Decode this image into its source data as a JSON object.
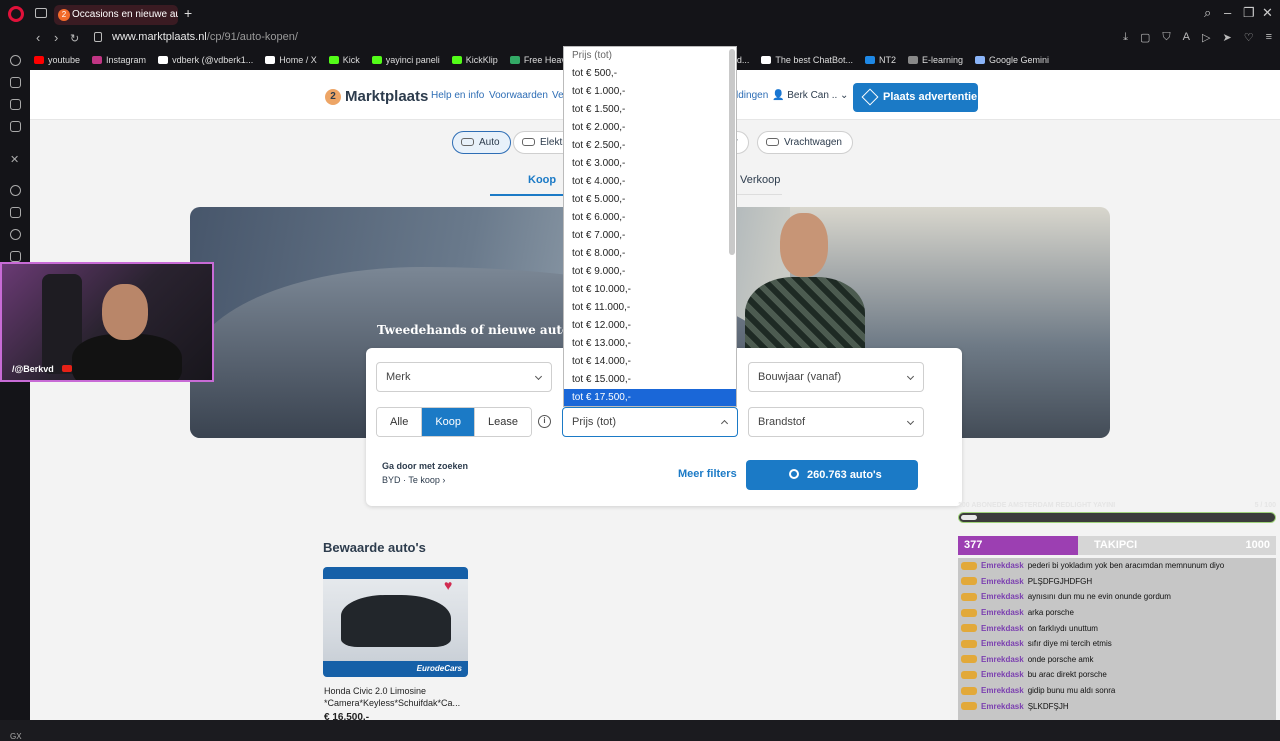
{
  "tab": {
    "title": "Occasions en nieuwe au",
    "badge": "2"
  },
  "address": {
    "host": "www.marktplaats.nl",
    "path": "/cp/91/auto-kopen/"
  },
  "bookmarks": [
    {
      "label": "youtube",
      "color": "#ff0000"
    },
    {
      "label": "Instagram",
      "color": "#c13584"
    },
    {
      "label": "vdberk (@vdberk1...",
      "color": "#ffffff"
    },
    {
      "label": "Home / X",
      "color": "#ffffff"
    },
    {
      "label": "Kick",
      "color": "#53fc18"
    },
    {
      "label": "yayinci paneli",
      "color": "#53fc18"
    },
    {
      "label": "KickKlip",
      "color": "#53fc18"
    },
    {
      "label": "Free Heavy Me",
      "color": "#33aa66"
    },
    {
      "label": "tech-c...",
      "color": "#888888"
    },
    {
      "label": "katlanabilir yarış d...",
      "color": "#f5821f"
    },
    {
      "label": "The best ChatBot...",
      "color": "#ffffff"
    },
    {
      "label": "NT2",
      "color": "#1e88e5"
    },
    {
      "label": "E-learning",
      "color": "#888888"
    },
    {
      "label": "Google Gemini",
      "color": "#8ab4f8"
    }
  ],
  "header": {
    "logo": "Marktplaats",
    "links": [
      "Help en info",
      "Voorwaarden",
      "Ve"
    ],
    "messages_tail": "ldingen",
    "user": "Berk Can ..",
    "place_ad": "Plaats advertentie"
  },
  "categories": [
    "Auto",
    "Elektr",
    "er",
    "Vrachtwagen"
  ],
  "buy_sell": {
    "buy": "Koop",
    "sell": "Verkoop"
  },
  "hero": {
    "title": "Tweedehands of nieuwe auto ko"
  },
  "search": {
    "brand": "Merk",
    "year": "Bouwjaar (vanaf)",
    "segment": [
      "Alle",
      "Koop",
      "Lease"
    ],
    "segment_active": "Koop",
    "price": "Prijs (tot)",
    "fuel": "Brandstof",
    "continue_title": "Ga door met zoeken",
    "continue_sub": "BYD · Te koop",
    "more_filters": "Meer filters",
    "results_button": "260.763 auto's"
  },
  "price_dropdown": {
    "options": [
      "Prijs (tot)",
      "tot € 500,-",
      "tot € 1.000,-",
      "tot € 1.500,-",
      "tot € 2.000,-",
      "tot € 2.500,-",
      "tot € 3.000,-",
      "tot € 4.000,-",
      "tot € 5.000,-",
      "tot € 6.000,-",
      "tot € 7.000,-",
      "tot € 8.000,-",
      "tot € 9.000,-",
      "tot € 10.000,-",
      "tot € 11.000,-",
      "tot € 12.000,-",
      "tot € 13.000,-",
      "tot € 14.000,-",
      "tot € 15.000,-",
      "tot € 17.500,-"
    ],
    "highlighted": "tot € 17.500,-"
  },
  "saved": {
    "title": "Bewaarde auto's",
    "card_title": "Honda Civic 2.0 Limosine *Camera*Keyless*Schuifdak*Ca...",
    "card_price": "€ 16.500,-",
    "card_banner": "EurodeCars"
  },
  "stream": {
    "cam_tag": "/@Berkvd",
    "goal_label": "100 ABONEDE AMSTERDAM REDLIGHT YAYINI",
    "goal_count": "5 / 100",
    "goal_progress": 0.05,
    "followers_current": "377",
    "followers_label": "TAKIPCI",
    "followers_max": "1000",
    "follow_progress": 0.377,
    "chat": [
      {
        "nick": "Emrekdask",
        "text": "pederi bi yokladım yok ben aracımdan memnunum diyo"
      },
      {
        "nick": "Emrekdask",
        "text": "PLŞDFGJHDFGH"
      },
      {
        "nick": "Emrekdask",
        "text": "aynısını dun mu ne evin onunde gordum"
      },
      {
        "nick": "Emrekdask",
        "text": "arka porsche"
      },
      {
        "nick": "Emrekdask",
        "text": "on farklıydı unuttum"
      },
      {
        "nick": "Emrekdask",
        "text": "sıfır diye mi tercih etmis"
      },
      {
        "nick": "Emrekdask",
        "text": "onde porsche amk"
      },
      {
        "nick": "Emrekdask",
        "text": "bu arac direkt porsche"
      },
      {
        "nick": "Emrekdask",
        "text": "gidip bunu mu aldı sonra"
      },
      {
        "nick": "Emrekdask",
        "text": "ŞLKDFŞJH"
      }
    ]
  }
}
